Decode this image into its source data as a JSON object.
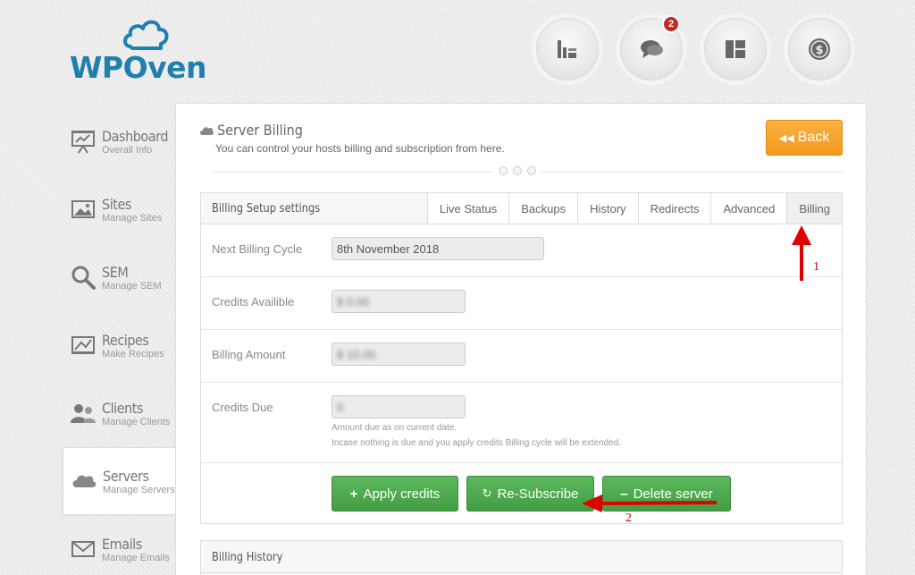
{
  "logo": {
    "text": "WPOven"
  },
  "top_icons": [
    {
      "name": "stats-icon"
    },
    {
      "name": "chat-icon",
      "badge": "2"
    },
    {
      "name": "layout-icon"
    },
    {
      "name": "dollar-icon"
    }
  ],
  "sidebar": {
    "items": [
      {
        "title": "Dashboard",
        "sub": "Overall Info",
        "icon": "presentation-icon"
      },
      {
        "title": "Sites",
        "sub": "Manage Sites",
        "icon": "image-icon"
      },
      {
        "title": "SEM",
        "sub": "Manage SEM",
        "icon": "magnifier-icon"
      },
      {
        "title": "Recipes",
        "sub": "Make Recipes",
        "icon": "recipe-icon"
      },
      {
        "title": "Clients",
        "sub": "Manage Clients",
        "icon": "users-icon"
      },
      {
        "title": "Servers",
        "sub": "Manage Servers",
        "icon": "cloud-icon",
        "active": true
      },
      {
        "title": "Emails",
        "sub": "Manage Emails",
        "icon": "envelope-icon"
      }
    ]
  },
  "panel": {
    "title": "Server Billing",
    "subtitle": "You can control your hosts billing and subscription from here.",
    "back_label": "Back"
  },
  "billing": {
    "header": "Billing Setup settings",
    "tabs": [
      "Live Status",
      "Backups",
      "History",
      "Redirects",
      "Advanced",
      "Billing"
    ],
    "active_tab": "Billing",
    "next_billing_label": "Next Billing Cycle",
    "next_billing_value": "8th November 2018",
    "credits_label": "Credits Availible",
    "credits_value": "$ 0.00",
    "amount_label": "Billing Amount",
    "amount_value": "$ 10.00",
    "due_label": "Credits Due",
    "due_value": "0",
    "hint1": "Amount due as on current date.",
    "hint2": "Incase nothing is due and you apply credits Billing cycle will be extended.",
    "apply_label": "Apply credits",
    "resubscribe_label": "Re-Subscribe",
    "delete_label": "Delete server"
  },
  "history": {
    "title": "Billing History"
  },
  "annotations": {
    "arrow1_label": "1",
    "arrow2_label": "2"
  },
  "colors": {
    "brand": "#1f7fae",
    "accent_orange": "#f39a1e",
    "green": "#4cae4c",
    "annotation_red": "#e00000"
  }
}
